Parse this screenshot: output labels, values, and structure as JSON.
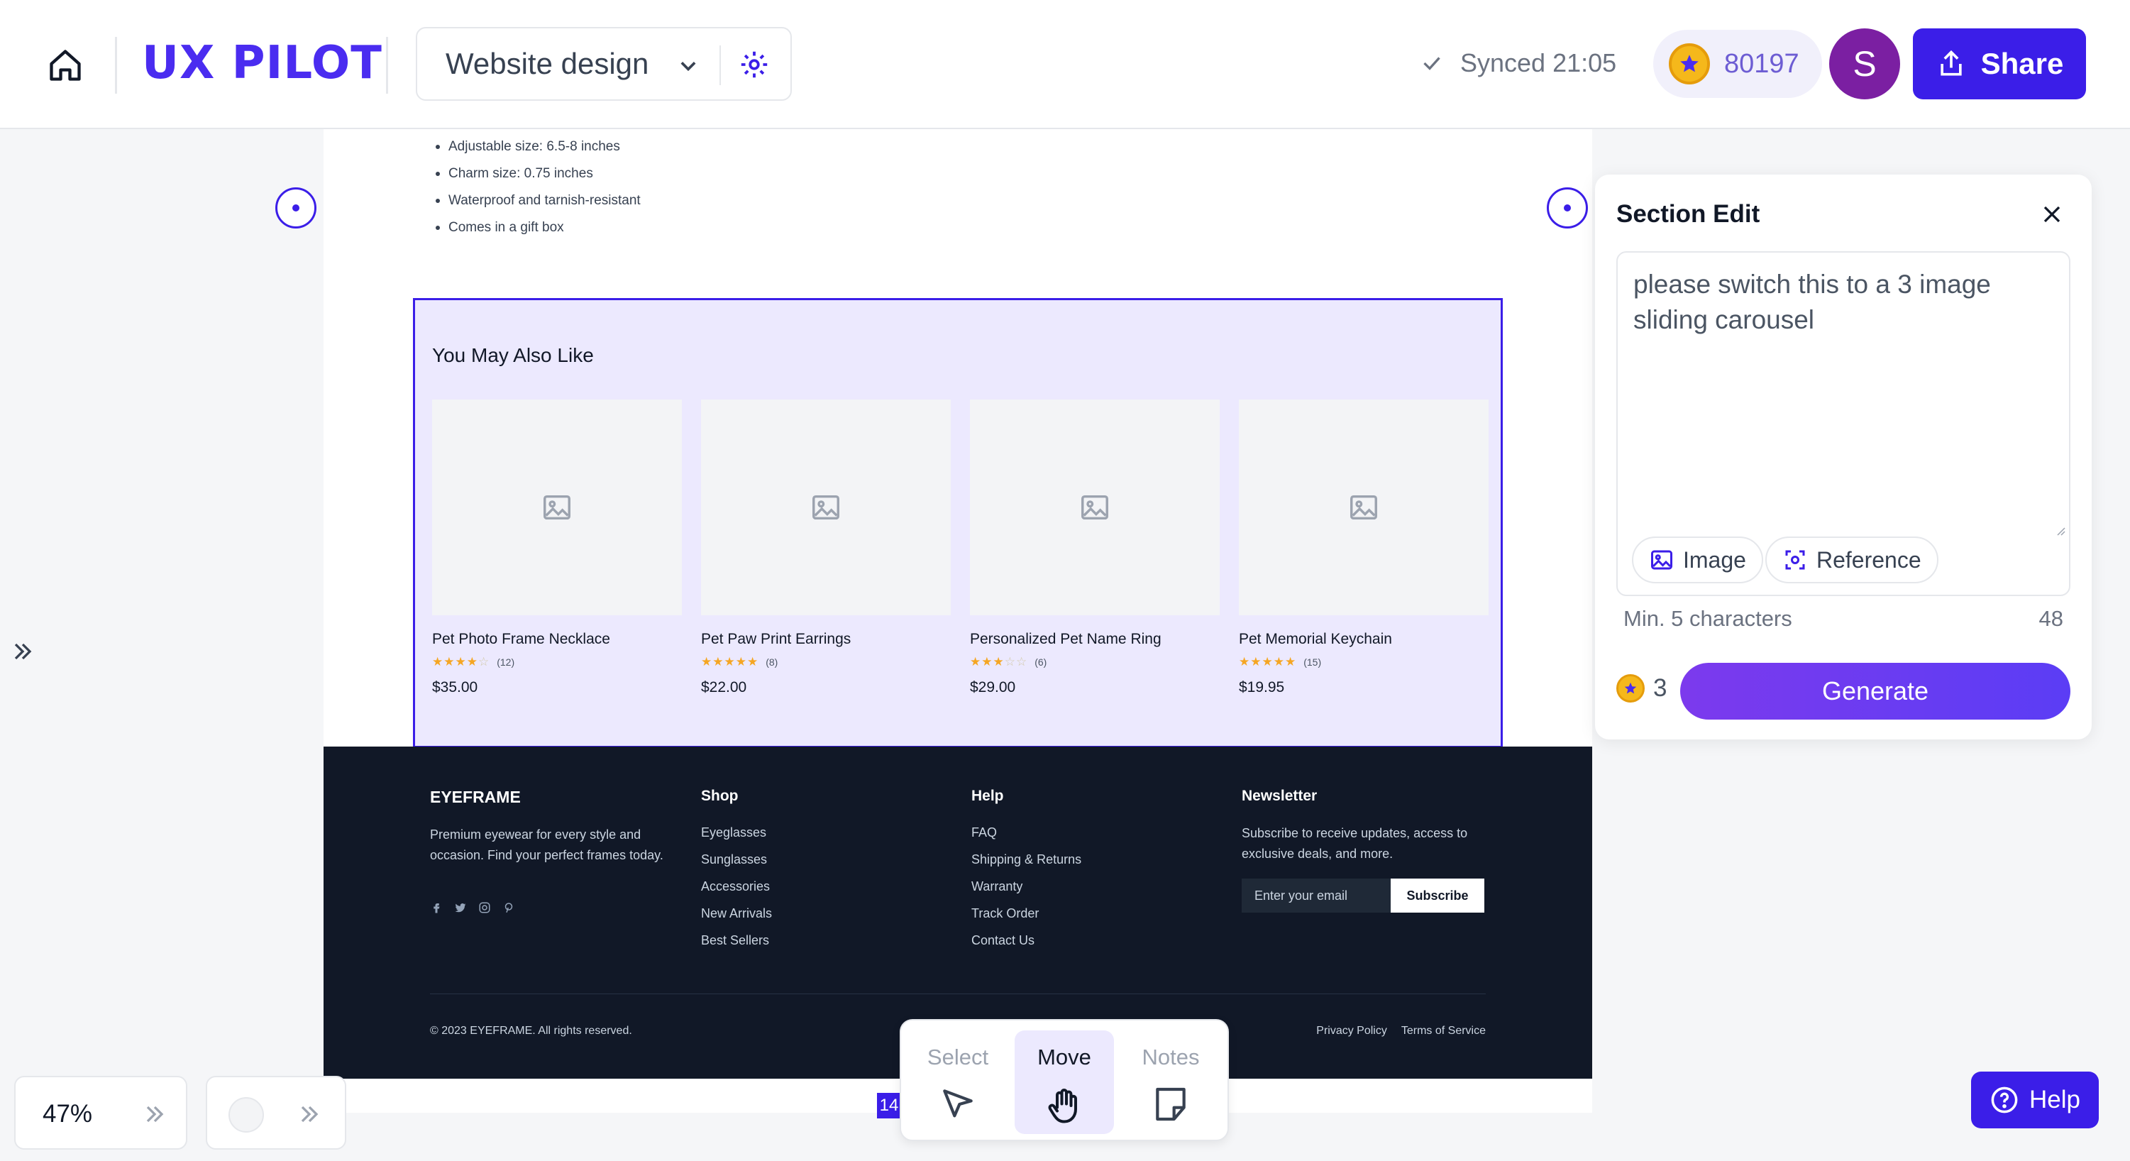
{
  "header": {
    "logo": "UX PILOT",
    "project_name": "Website design",
    "sync_status": "Synced 21:05",
    "credits": "80197",
    "avatar_initial": "S",
    "share_label": "Share"
  },
  "canvas": {
    "bullets": [
      "Adjustable size: 6.5-8 inches",
      "Charm size: 0.75 inches",
      "Waterproof and tarnish-resistant",
      "Comes in a gift box"
    ],
    "related": {
      "title": "You May Also Like",
      "products": [
        {
          "name": "Pet Photo Frame Necklace",
          "rating": 4,
          "count": "(12)",
          "price": "$35.00"
        },
        {
          "name": "Pet Paw Print Earrings",
          "rating": 5,
          "count": "(8)",
          "price": "$22.00"
        },
        {
          "name": "Personalized Pet Name Ring",
          "rating": 3,
          "count": "(6)",
          "price": "$29.00"
        },
        {
          "name": "Pet Memorial Keychain",
          "rating": 5,
          "count": "(15)",
          "price": "$19.95"
        }
      ]
    },
    "footer": {
      "brand": "EYEFRAME",
      "description": "Premium eyewear for every style and occasion. Find your perfect frames today.",
      "shop": {
        "title": "Shop",
        "links": [
          "Eyeglasses",
          "Sunglasses",
          "Accessories",
          "New Arrivals",
          "Best Sellers"
        ]
      },
      "help": {
        "title": "Help",
        "links": [
          "FAQ",
          "Shipping & Returns",
          "Warranty",
          "Track Order",
          "Contact Us"
        ]
      },
      "newsletter": {
        "title": "Newsletter",
        "text": "Subscribe to receive updates, access to exclusive deals, and more.",
        "placeholder": "Enter your email",
        "button": "Subscribe"
      },
      "copyright": "© 2023 EYEFRAME. All rights reserved.",
      "legal": [
        "Privacy Policy",
        "Terms of Service"
      ]
    }
  },
  "panel": {
    "title": "Section Edit",
    "prompt": "please switch this to a 3 image sliding carousel",
    "image_label": "Image",
    "reference_label": "Reference",
    "hint": "Min. 5 characters",
    "char_count": "48",
    "cost": "3",
    "generate_label": "Generate"
  },
  "bottom": {
    "zoom": "47%",
    "page_number": "14",
    "tools": [
      {
        "label": "Select",
        "active": false
      },
      {
        "label": "Move",
        "active": true
      },
      {
        "label": "Notes",
        "active": false
      }
    ],
    "help_label": "Help"
  },
  "colors": {
    "brand": "#4a2cf0",
    "primary_button": "#3b1ee8",
    "selection_fill": "#ece9fe",
    "footer_bg": "#111827",
    "avatar_bg": "#7b1fa2",
    "star": "#f5a623"
  }
}
